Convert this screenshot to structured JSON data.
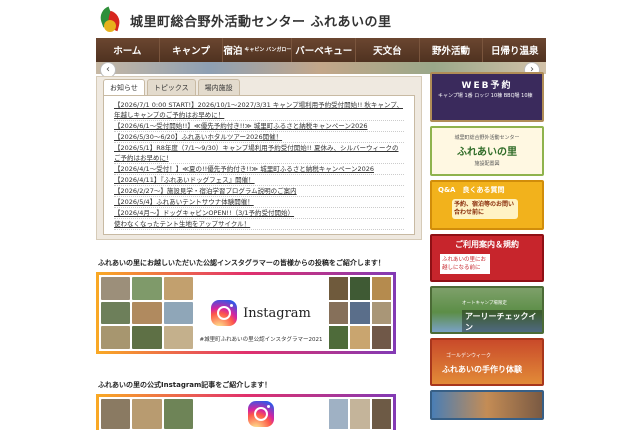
{
  "header": {
    "title": "城里町総合野外活動センター ふれあいの里"
  },
  "nav": {
    "items": [
      {
        "label": "ホーム"
      },
      {
        "label": "キャンプ"
      },
      {
        "label": "宿泊",
        "sub": "キャビン バンガロー"
      },
      {
        "label": "バーベキュー"
      },
      {
        "label": "天文台"
      },
      {
        "label": "野外活動"
      },
      {
        "label": "日帰り温泉"
      }
    ]
  },
  "slider": {
    "prev_icon": "‹",
    "next_icon": "›"
  },
  "news": {
    "tabs": [
      "お知らせ",
      "トピックス",
      "場内施設"
    ],
    "items": [
      "【2026/7/1 0:00 START!】2026/10/1～2027/3/31 キャンプ場利用予約受付開始!! 秋キャンプ、年越しキャンプのご予約はお早めに！",
      "【2026/6/1～受付開始!!】≪優先予約付き!!≫ 城里町ふるさと納税キャンペーン2026",
      "【2026/5/30～6/20】ふれあいホタルツアー2026開催！",
      "【2026/5/1】R8年度（7/1～9/30）キャンプ場利用予約受付開始!! 夏休み、シルバーウィークのご予約はお早めに!",
      "【2026/4/1～受付！】≪夏の!!優先予約付き!!≫ 城里町ふるさと納税キャンペーン2026",
      "【2026/4/11】『ふれあいドッグフェス』開催！",
      "【2026/2/27～】施設見学・宿泊学習プログラム説明のご案内",
      "【2026/5/4】ふれあいテントサウナ体験開催！",
      "【2026/4月～】ドッグキャビンOPEN!!（3/1予約受付開始）",
      "使わなくなったテント生地をアップサイクル！"
    ]
  },
  "instagram1": {
    "heading": "ふれあいの里にお越しいただいた公認インスタグラマーの皆様からの投稿をご紹介します！",
    "word": "Instagram",
    "caption": "#城里町ふれあいの里公認インスタグラマー2021"
  },
  "instagram2": {
    "heading": "ふれあいの里の公式Instagram記事をご紹介します！"
  },
  "sidebar": {
    "web": {
      "title": "WEB予約",
      "sub": "キャンプ場 1番 ロッジ 10棟 BBQ場 10棟"
    },
    "fureai": {
      "top": "城里町総合野外活動センター",
      "main": "ふれあいの里",
      "bottom": "施設配置図"
    },
    "qa": {
      "title": "Q&A　良くある質問",
      "sub": "予約、宿泊等のお問い合わせ前に"
    },
    "guide": {
      "title": "ご利用案内＆規約",
      "sub": "ふれあいの里にお越しになる前に"
    },
    "checkin": {
      "small": "オートキャンプ場限定",
      "title": "アーリーチェックイン"
    },
    "craft": {
      "small": "ゴールデンウィーク",
      "title": "ふれあいの手作り体験"
    }
  },
  "colors": {
    "nav_bg": "#5b3b27",
    "news_bg": "#efe9e0",
    "instagram_gradient": [
      "#f9a825",
      "#e1306c",
      "#833ab4"
    ]
  }
}
